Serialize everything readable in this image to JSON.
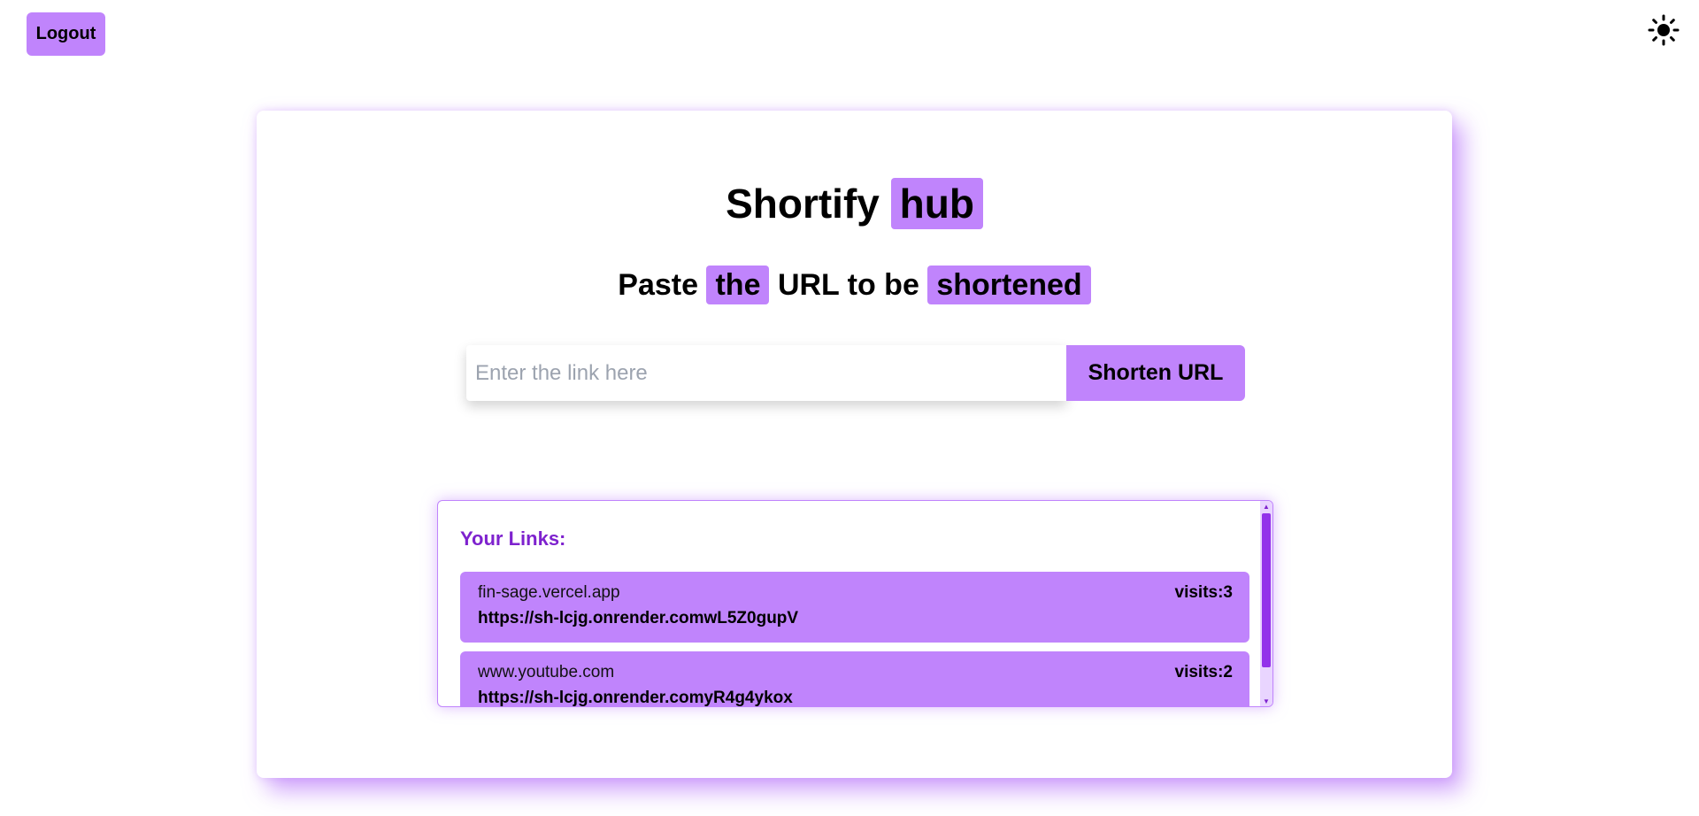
{
  "header": {
    "logout_label": "Logout",
    "theme_icon": "sun-icon"
  },
  "main": {
    "title_prefix": "Shortify",
    "title_highlight": "hub",
    "subtitle": {
      "part1": "Paste",
      "part2": "the",
      "part3": "URL to be",
      "part4": "shortened"
    },
    "input_placeholder": "Enter the link here",
    "input_value": "",
    "shorten_label": "Shorten URL"
  },
  "links": {
    "heading": "Your Links:",
    "items": [
      {
        "original": "fin-sage.vercel.app",
        "visits": "visits:3",
        "short": "https://sh-lcjg.onrender.comwL5Z0gupV"
      },
      {
        "original": "www.youtube.com",
        "visits": "visits:2",
        "short": "https://sh-lcjg.onrender.comyR4g4ykox"
      }
    ]
  },
  "colors": {
    "accent": "#c084fc",
    "accent_dark": "#7e22ce",
    "scroll_thumb": "#9333ea"
  }
}
